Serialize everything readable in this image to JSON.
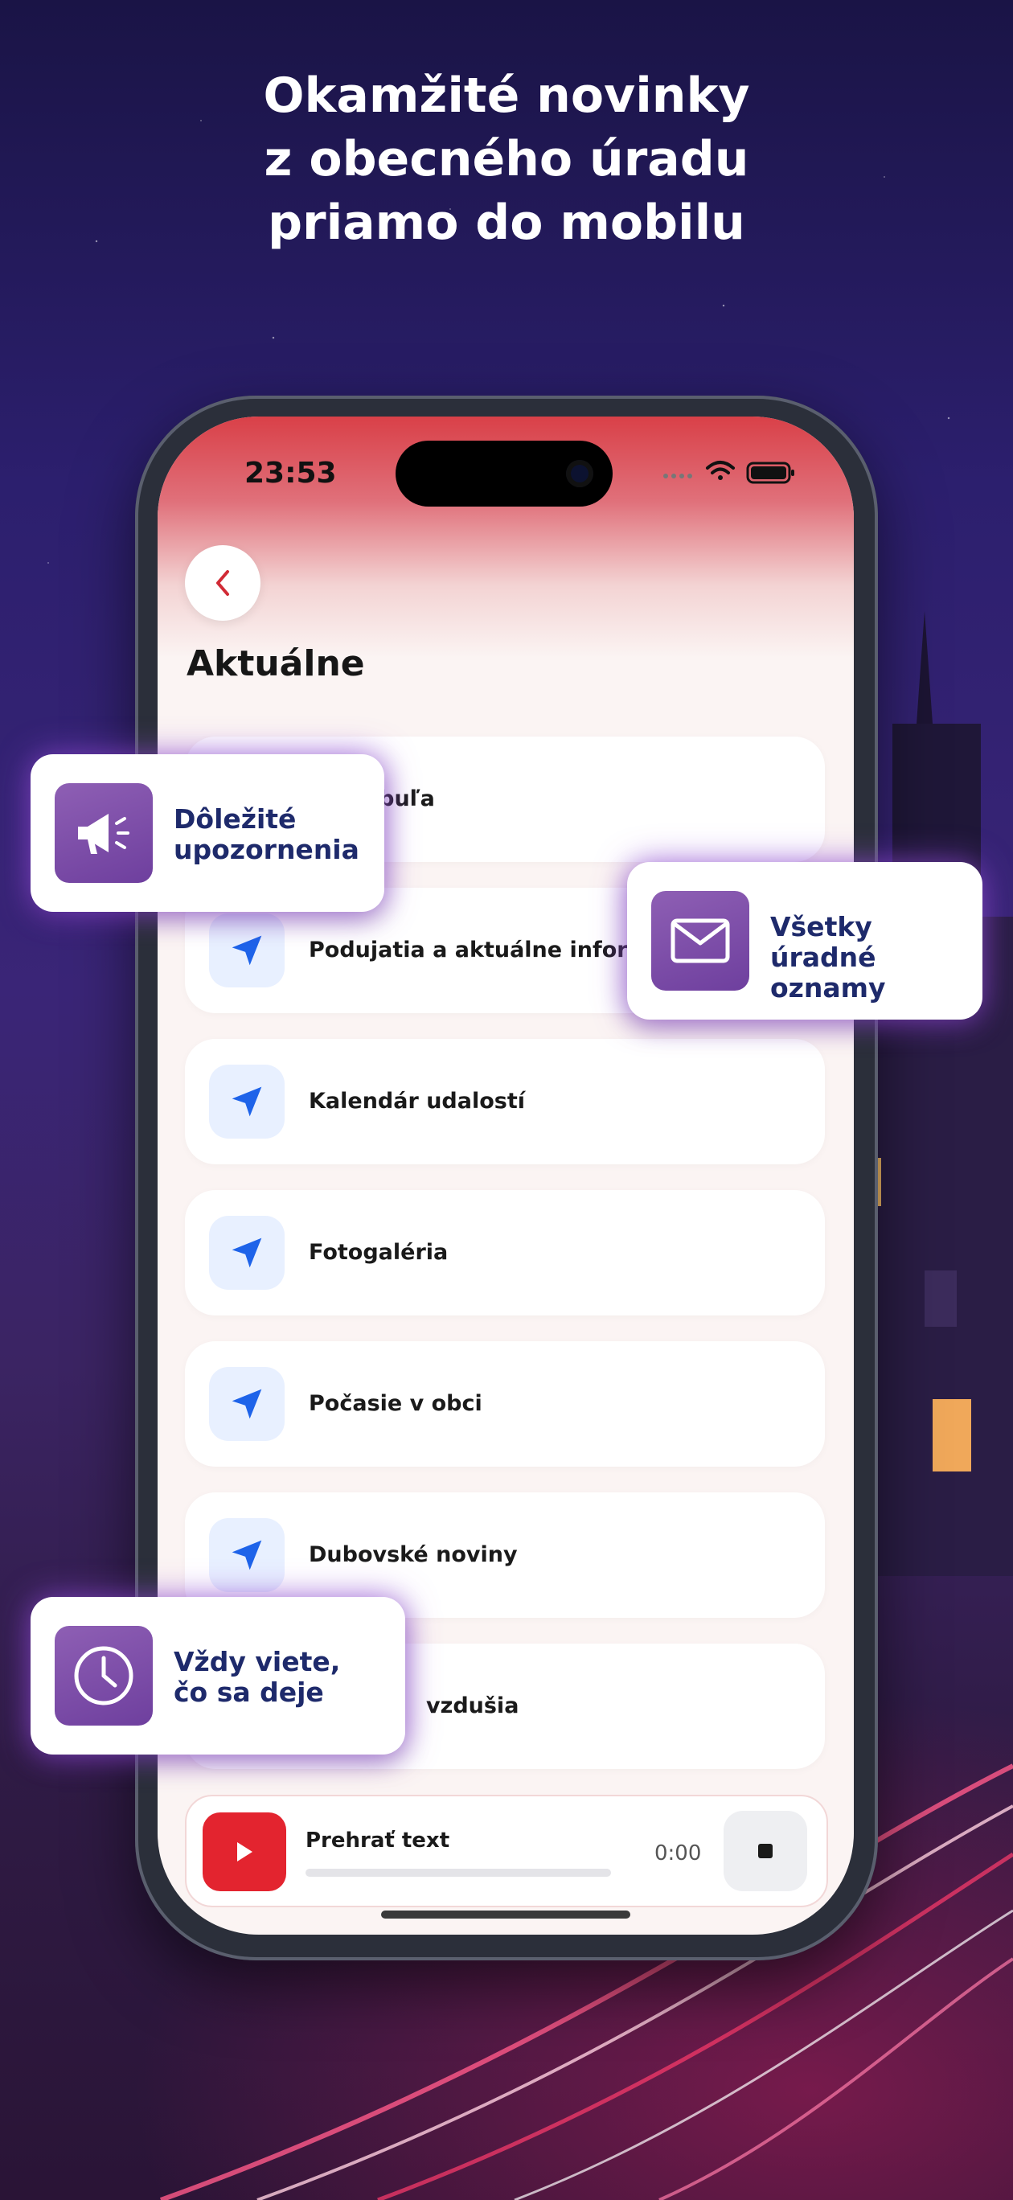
{
  "promo": {
    "headline_line1": "Okamžité novinky",
    "headline_line2": "z obecného úradu",
    "headline_line3": "priamo do mobilu"
  },
  "status_bar": {
    "time": "23:53"
  },
  "screen": {
    "title": "Aktuálne",
    "items": [
      {
        "label": "tabuľa"
      },
      {
        "label": "Podujatia a aktuálne informáci"
      },
      {
        "label": "Kalendár udalostí"
      },
      {
        "label": "Fotogaléria"
      },
      {
        "label": "Počasie v obci"
      },
      {
        "label": "Dubovské noviny"
      },
      {
        "label": "vzdušia"
      }
    ]
  },
  "player": {
    "label": "Prehrať text",
    "time": "0:00",
    "progress": 0
  },
  "callouts": {
    "important": {
      "line1": "Dôležité",
      "line2": "upozornenia",
      "icon": "megaphone-icon"
    },
    "all_notices": {
      "line1": "Všetky",
      "line2": "úradné oznamy",
      "icon": "mail-icon"
    },
    "always_know": {
      "line1": "Vždy viete,",
      "line2": "čo sa deje",
      "icon": "clock-icon"
    }
  },
  "colors": {
    "accent_red": "#e3242f",
    "callout_purple": "#7a4aa6",
    "list_icon_blue": "#1e63e9",
    "callout_text": "#1e2a6b"
  }
}
